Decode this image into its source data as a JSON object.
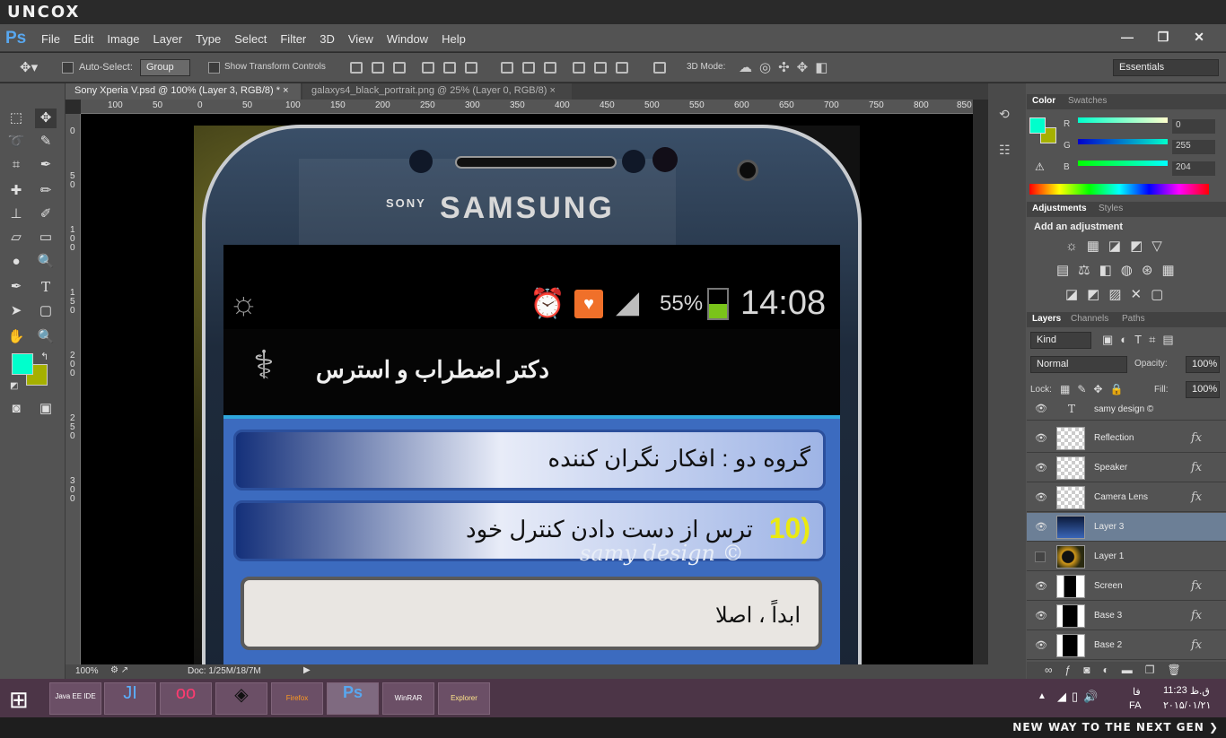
{
  "brand": {
    "top": "UNCOX",
    "bottom": "NEW WAY TO THE NEXT GEN ❯"
  },
  "app": {
    "logo": "Ps",
    "menus": [
      "File",
      "Edit",
      "Image",
      "Layer",
      "Type",
      "Select",
      "Filter",
      "3D",
      "View",
      "Window",
      "Help"
    ],
    "window_buttons": [
      "—",
      "❐",
      "✕"
    ]
  },
  "options": {
    "auto_select_label": "Auto-Select:",
    "auto_select_value": "Group",
    "show_transform_label": "Show Transform Controls",
    "mode3d_label": "3D Mode:",
    "workspace": "Essentials"
  },
  "tabs": [
    {
      "label": "Sony Xperia V.psd @ 100% (Layer 3, RGB/8) *",
      "close": "×"
    },
    {
      "label": "galaxys4_black_portrait.png @ 25% (Layer 0, RGB/8)",
      "close": "×"
    }
  ],
  "ruler": {
    "top": [
      "100",
      "50",
      "0",
      "50",
      "100",
      "150",
      "200",
      "250",
      "300",
      "350",
      "400",
      "450",
      "500",
      "550",
      "600",
      "650",
      "700",
      "750",
      "800",
      "850"
    ],
    "left": [
      "0",
      "5",
      "0",
      "1",
      "0",
      "0",
      "1",
      "5",
      "0",
      "2",
      "0",
      "0",
      "2",
      "5",
      "0",
      "3",
      "0",
      "0"
    ]
  },
  "status": {
    "zoom": "100%",
    "doc": "Doc: 1/25M/18/7M"
  },
  "canvas": {
    "brand_small": "SONY",
    "brand": "SAMSUNG",
    "battery": "55%",
    "time": "14:08",
    "app_title": "دکتر اضطراب و استرس",
    "group_label": "گروه دو : افکار نگران کننده",
    "question_num": "10)",
    "question": "ترس از دست دادن کنترل خود",
    "answer": "ابداً ، اصلا",
    "watermark": "samy design ©"
  },
  "color_panel": {
    "tabs": [
      "Color",
      "Swatches"
    ],
    "r_label": "R",
    "g_label": "G",
    "b_label": "B",
    "r": "0",
    "g": "255",
    "b": "204",
    "fg": "#00ffcc",
    "bg": "#a5b000"
  },
  "adjustments": {
    "tabs": [
      "Adjustments",
      "Styles"
    ],
    "title": "Add an adjustment"
  },
  "layers_panel": {
    "tabs": [
      "Layers",
      "Channels",
      "Paths"
    ],
    "kind": "Kind",
    "blend": "Normal",
    "opacity_label": "Opacity:",
    "opacity": "100%",
    "lock_label": "Lock:",
    "fill_label": "Fill:",
    "fill": "100%",
    "layers": [
      {
        "name": "samy design ©",
        "fx": "",
        "visible": "👁"
      },
      {
        "name": "Reflection",
        "fx": "fx",
        "visible": "👁"
      },
      {
        "name": "Speaker",
        "fx": "fx",
        "visible": "👁"
      },
      {
        "name": "Camera Lens",
        "fx": "fx",
        "visible": "👁"
      },
      {
        "name": "Layer 3",
        "fx": "",
        "visible": "👁"
      },
      {
        "name": "Layer 1",
        "fx": "",
        "visible": ""
      },
      {
        "name": "Screen",
        "fx": "fx",
        "visible": "👁"
      },
      {
        "name": "Base 3",
        "fx": "fx",
        "visible": "👁"
      },
      {
        "name": "Base 2",
        "fx": "fx",
        "visible": "👁"
      }
    ]
  },
  "taskbar": {
    "apps": [
      "Java EE IDE",
      "JI",
      "oo",
      "◈",
      "Firefox",
      "Ps",
      "WinRAR",
      "Explorer"
    ],
    "lang": "FA",
    "day": "ق.ظ",
    "time": "11:23",
    "date": "۲۰۱۵/۰۱/۲۱",
    "tray_label": "فا"
  }
}
